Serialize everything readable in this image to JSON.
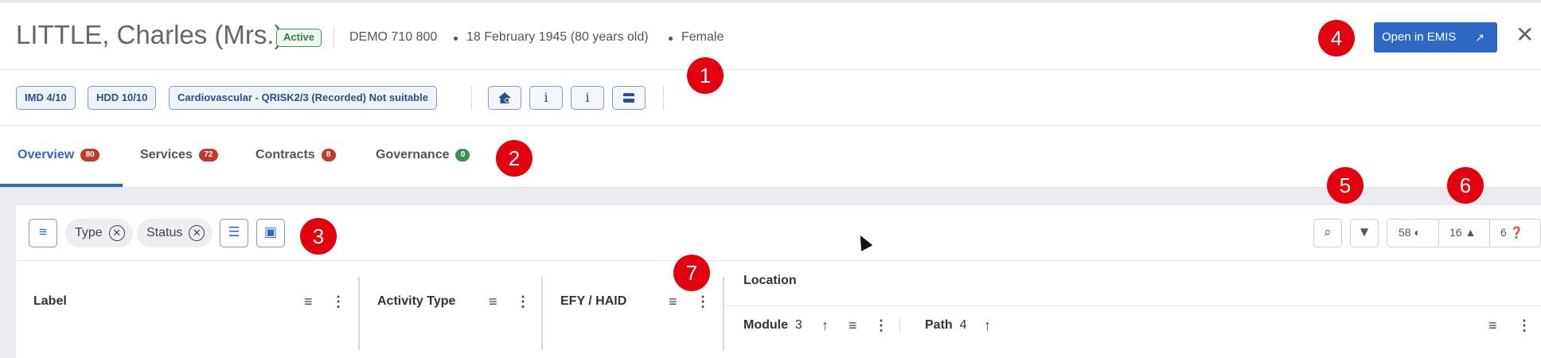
{
  "header": {
    "patient_name": "LITTLE, Charles (Mrs.)",
    "status": "Active",
    "nhs_number": "DEMO 710 800",
    "dob": "18 February 1945 (80 years old)",
    "gender": "Female",
    "open_button": "Open in EMIS",
    "close_icon": "close-icon"
  },
  "tags": [
    "IMD 4/10",
    "HDD 10/10",
    "Cardiovascular - QRISK2/3 (Recorded) Not suitable"
  ],
  "info_buttons": [
    "home-person-icon",
    "info-icon",
    "info-icon",
    "card-icon"
  ],
  "tabs": [
    {
      "label": "Overview",
      "count": "80",
      "color": "#c0392b"
    },
    {
      "label": "Services",
      "count": "72",
      "color": "#c0392b"
    },
    {
      "label": "Contracts",
      "count": "8",
      "color": "#c0392b"
    },
    {
      "label": "Governance",
      "count": "0",
      "color": "#3e8e57"
    }
  ],
  "toolbar": {
    "chips": [
      "Type",
      "Status"
    ],
    "counters": [
      "58",
      "16",
      "6"
    ]
  },
  "columns": {
    "label": "Label",
    "activity_type": "Activity Type",
    "efy_haid": "EFY / HAID",
    "location": "Location",
    "module": "Module",
    "module_count": "3",
    "path": "Path",
    "path_count": "4"
  },
  "markers": [
    "1",
    "2",
    "3",
    "4",
    "5",
    "6",
    "7"
  ],
  "colors": {
    "accent": "#2f67c2",
    "marker": "#e3000f",
    "active": "#3e9a57"
  }
}
